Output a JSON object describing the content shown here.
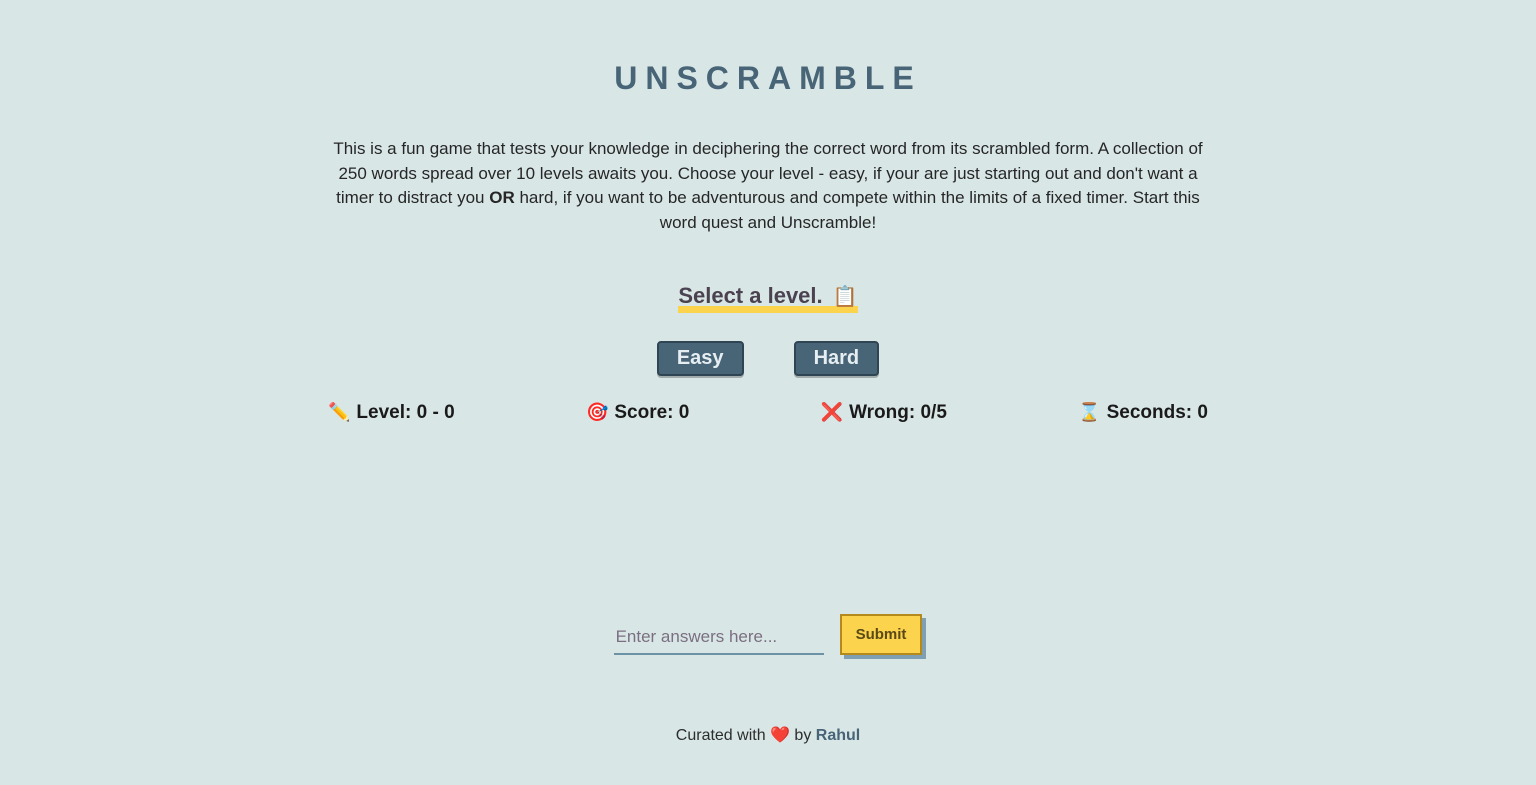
{
  "title": "UNSCRAMBLE",
  "intro": {
    "part1": "This is a fun game that tests your knowledge in deciphering the correct word from its scrambled form. A collection of 250 words spread over 10 levels awaits you. Choose your level - easy, if your are just starting out and don't want a timer to distract you ",
    "or": "OR",
    "part2": " hard, if you want to be adventurous and compete within the limits of a fixed timer. Start this word quest and Unscramble!"
  },
  "select_level_label": "Select a level.",
  "buttons": {
    "easy": "Easy",
    "hard": "Hard",
    "submit": "Submit"
  },
  "stats": {
    "level_label": "Level: ",
    "level_value": "0 - 0",
    "score_label": "Score: ",
    "score_value": "0",
    "wrong_label": "Wrong: ",
    "wrong_value": "0/5",
    "seconds_label": "Seconds: ",
    "seconds_value": "0"
  },
  "answer_placeholder": "Enter answers here...",
  "footer": {
    "prefix": "Curated with ",
    "by": " by ",
    "author": "Rahul"
  },
  "icons": {
    "clipboard": "📋",
    "pencil": "✏️",
    "target": "🎯",
    "cross": "❌",
    "hourglass": "⌛",
    "heart": "❤️"
  }
}
